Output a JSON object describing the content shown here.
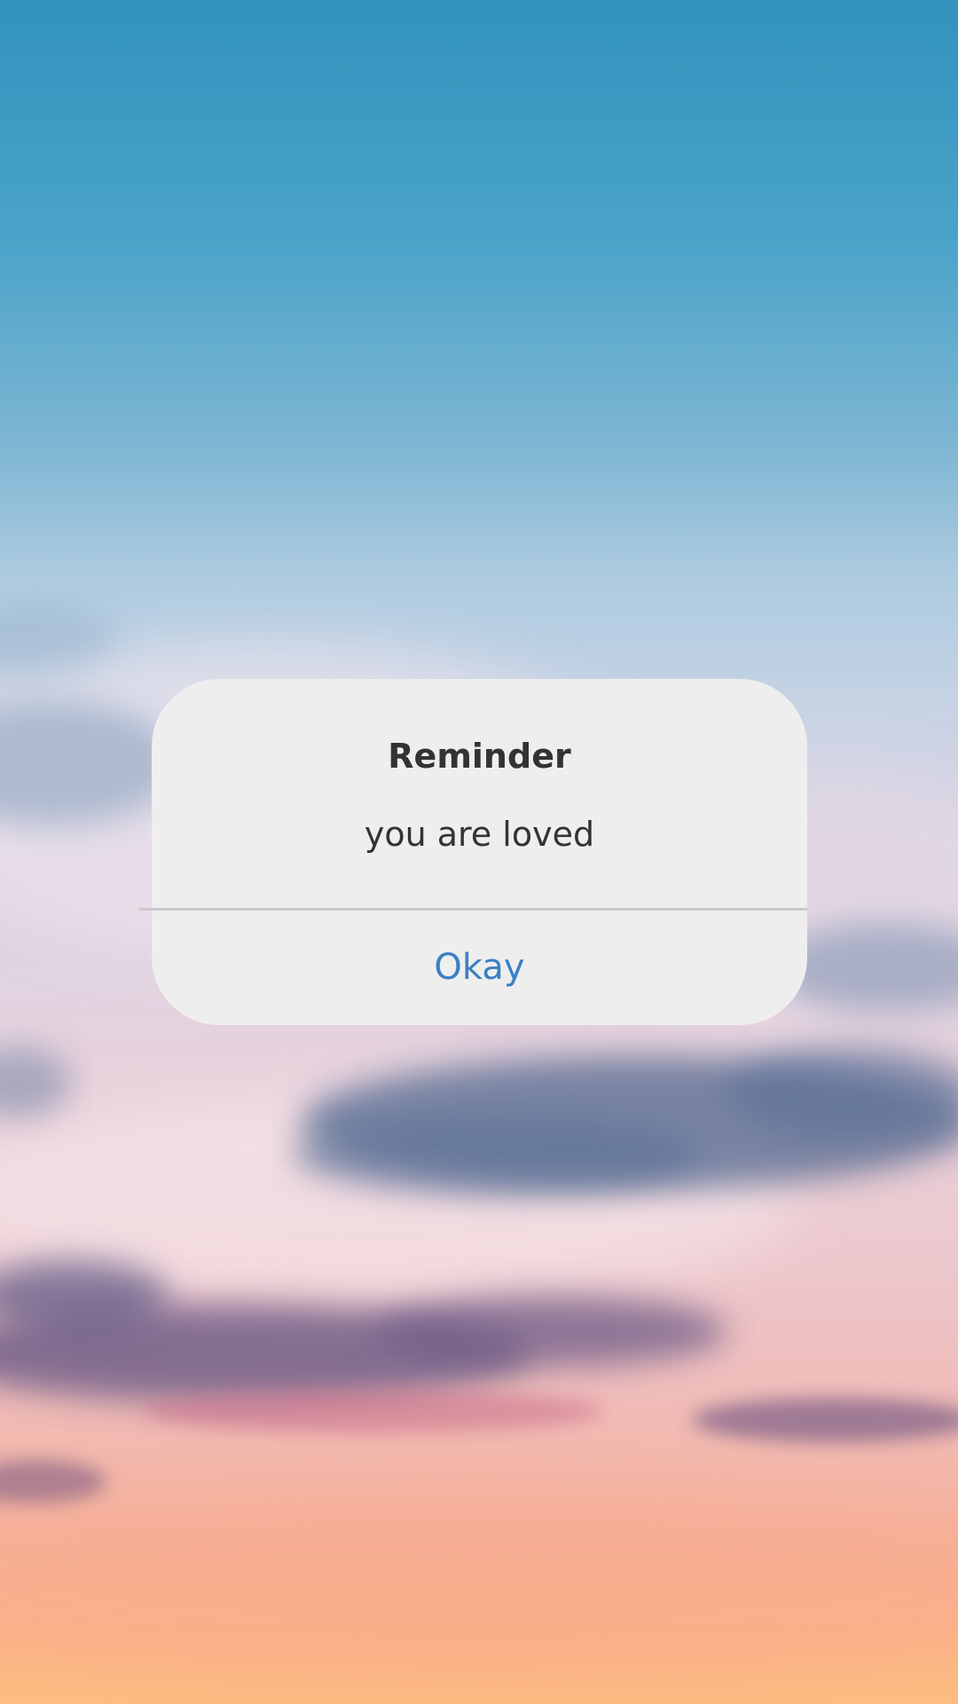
{
  "dialog": {
    "title": "Reminder",
    "message": "you are loved",
    "button_label": "Okay"
  },
  "colors": {
    "dialog_background": "#eeeeef",
    "text": "#333333",
    "button_text": "#3b80c4",
    "divider": "#c9c9cb"
  }
}
